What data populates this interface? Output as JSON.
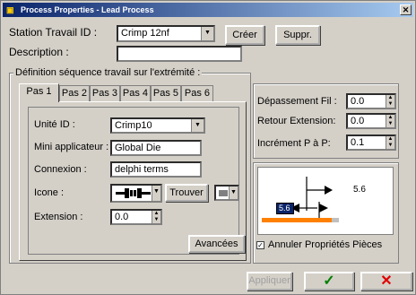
{
  "window": {
    "title": "Process Properties - Lead Process"
  },
  "station": {
    "label": "Station Travail ID :",
    "value": "Crimp 12nf",
    "create_button": "Créer",
    "delete_button": "Suppr."
  },
  "description": {
    "label": "Description :",
    "value": ""
  },
  "definition": {
    "group_label": "Définition séquence travail sur l'extrémité :",
    "tabs": [
      "Pas 1",
      "Pas 2",
      "Pas 3",
      "Pas 4",
      "Pas 5",
      "Pas 6"
    ],
    "active_tab": 0,
    "unite": {
      "label": "Unité ID :",
      "value": "Crimp10"
    },
    "mini_applicateur": {
      "label": "Mini applicateur :",
      "value": "Global Die"
    },
    "connexion": {
      "label": "Connexion :",
      "value": "delphi terms"
    },
    "icone": {
      "label": "Icone :",
      "trouver_button": "Trouver"
    },
    "extension": {
      "label": "Extension :",
      "value": "0.0"
    },
    "advanced_button": "Avancées"
  },
  "right_panel": {
    "depassement": {
      "label": "Dépassement Fil :",
      "value": "0.0"
    },
    "retour": {
      "label": "Retour Extension:",
      "value": "0.0"
    },
    "increment": {
      "label": "Incrément P à P:",
      "value": "0.1"
    }
  },
  "preview": {
    "value_label_right": "5.6",
    "value_box": "5.6",
    "accent_bar_color": "#ff8000"
  },
  "annuler": {
    "label": "Annuler Propriétés Pièces",
    "checked": true
  },
  "footer": {
    "apply_button": "Appliquer",
    "ok_icon": "check-icon",
    "cancel_icon": "x-icon"
  }
}
